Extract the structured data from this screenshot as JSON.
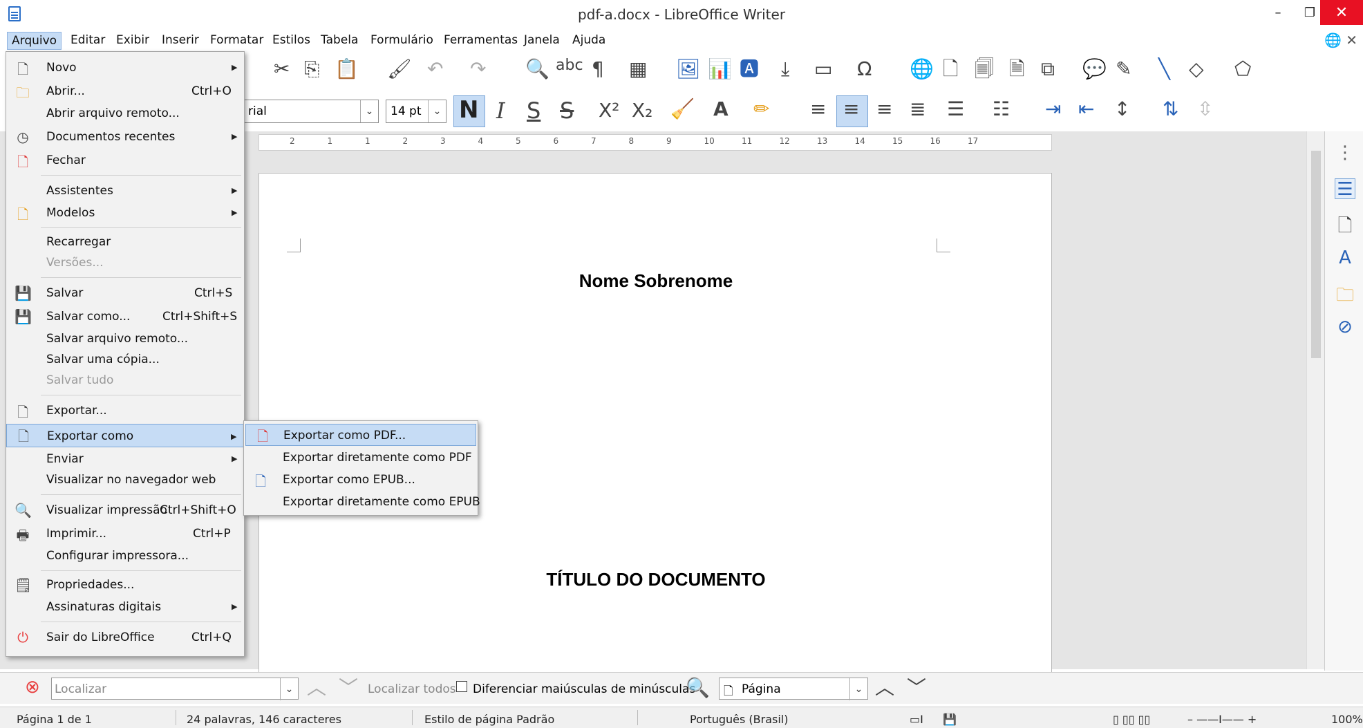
{
  "window": {
    "title": "pdf-a.docx - LibreOffice Writer",
    "min": "–",
    "max": "❐",
    "close": "✕"
  },
  "menubar": {
    "items": [
      "Arquivo",
      "Editar",
      "Exibir",
      "Inserir",
      "Formatar",
      "Estilos",
      "Tabela",
      "Formulário",
      "Ferramentas",
      "Janela",
      "Ajuda"
    ],
    "right_icon": "🌐 ✕"
  },
  "toolbar": {
    "font_name": "rial",
    "font_size": "14 pt",
    "bold": "N",
    "italic": "I",
    "underline": "S",
    "strike": "S",
    "superscript": "X²",
    "subscript": "X₂"
  },
  "ruler": {
    "labels": [
      "2",
      "1",
      "1",
      "2",
      "3",
      "4",
      "5",
      "6",
      "7",
      "8",
      "9",
      "10",
      "11",
      "12",
      "13",
      "14",
      "15",
      "16",
      "17"
    ]
  },
  "document": {
    "heading1": "Nome Sobrenome",
    "heading2": "TÍTULO DO DOCUMENTO"
  },
  "file_menu": {
    "items": [
      {
        "label": "Novo",
        "shortcut": "",
        "submenu": true,
        "icon": "new-document-icon"
      },
      {
        "label": "Abrir...",
        "shortcut": "Ctrl+O",
        "icon": "open-folder-icon"
      },
      {
        "label": "Abrir arquivo remoto...",
        "shortcut": ""
      },
      {
        "label": "Documentos recentes",
        "submenu": true,
        "icon": "clock-icon"
      },
      {
        "label": "Fechar",
        "icon": "close-document-icon"
      },
      {
        "label": "Assistentes",
        "submenu": true
      },
      {
        "label": "Modelos",
        "submenu": true,
        "icon": "templates-icon"
      },
      {
        "label": "Recarregar"
      },
      {
        "label": "Versões...",
        "disabled": true
      },
      {
        "label": "Salvar",
        "shortcut": "Ctrl+S",
        "icon": "save-icon"
      },
      {
        "label": "Salvar como...",
        "shortcut": "Ctrl+Shift+S",
        "icon": "save-as-icon"
      },
      {
        "label": "Salvar arquivo remoto..."
      },
      {
        "label": "Salvar uma cópia..."
      },
      {
        "label": "Salvar tudo",
        "disabled": true
      },
      {
        "label": "Exportar...",
        "icon": "export-icon"
      },
      {
        "label": "Exportar como",
        "submenu": true,
        "icon": "export-as-icon",
        "highlighted": true
      },
      {
        "label": "Enviar",
        "submenu": true
      },
      {
        "label": "Visualizar no navegador web"
      },
      {
        "label": "Visualizar impressão",
        "shortcut": "Ctrl+Shift+O",
        "icon": "print-preview-icon"
      },
      {
        "label": "Imprimir...",
        "shortcut": "Ctrl+P",
        "icon": "printer-icon"
      },
      {
        "label": "Configurar impressora..."
      },
      {
        "label": "Propriedades...",
        "icon": "properties-icon"
      },
      {
        "label": "Assinaturas digitais",
        "submenu": true
      },
      {
        "label": "Sair do LibreOffice",
        "shortcut": "Ctrl+Q",
        "icon": "power-icon"
      }
    ]
  },
  "export_submenu": {
    "items": [
      {
        "label": "Exportar como PDF...",
        "icon": "pdf-icon",
        "highlighted": true
      },
      {
        "label": "Exportar diretamente como PDF"
      },
      {
        "label": "Exportar como EPUB...",
        "icon": "epub-icon"
      },
      {
        "label": "Exportar diretamente como EPUB"
      }
    ]
  },
  "findbar": {
    "placeholder": "Localizar",
    "find_all": "Localizar todos",
    "match_case": "Diferenciar maiúsculas de minúsculas",
    "navigate": "Página"
  },
  "statusbar": {
    "page": "Página 1 de 1",
    "words": "24 palavras, 146 caracteres",
    "style": "Estilo de página Padrão",
    "language": "Português (Brasil)",
    "zoom": "100%"
  },
  "colors": {
    "highlight": "#c6dcf5",
    "close_red": "#e81123",
    "accent_blue": "#2a63b8"
  }
}
